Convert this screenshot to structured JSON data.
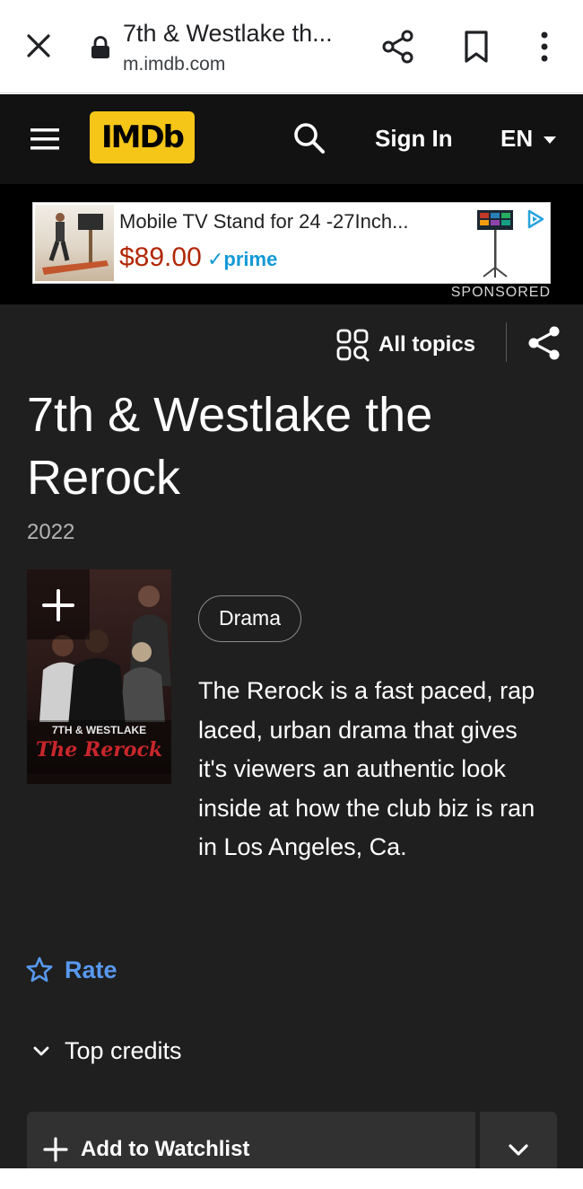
{
  "browser": {
    "page_title": "7th & Westlake th...",
    "url": "m.imdb.com"
  },
  "nav": {
    "logo": "IMDb",
    "sign_in": "Sign In",
    "language": "EN"
  },
  "ad": {
    "title": "Mobile TV Stand for 24 -27Inch...",
    "price": "$89.00",
    "prime": "✓prime",
    "sponsored": "SPONSORED"
  },
  "title_page": {
    "all_topics": "All topics",
    "title": "7th & Westlake the Rerock",
    "year": "2022",
    "poster_text_line1": "7TH & WESTLAKE",
    "poster_text_line2": "The Rerock",
    "genre": "Drama",
    "plot": "The Rerock is a fast paced, rap laced, urban drama that gives it's viewers an authentic look inside at how the club biz is ran in Los Angeles, Ca.",
    "rate": "Rate",
    "top_credits": "Top credits",
    "add_to_watchlist": "Add to Watchlist"
  },
  "colors": {
    "imdb_yellow": "#f5c518",
    "background": "#1f1f1f",
    "nav_background": "#121212",
    "link_blue": "#5799ef",
    "button_grey": "#313131"
  },
  "icons": {
    "close": "close-icon",
    "lock": "lock-icon",
    "share": "share-icon",
    "bookmark": "bookmark-icon",
    "more": "more-vertical-icon",
    "menu": "hamburger-menu-icon",
    "search": "search-icon",
    "topics": "topics-grid-icon",
    "star": "star-outline-icon",
    "chevron": "chevron-down-icon",
    "plus": "plus-icon"
  }
}
